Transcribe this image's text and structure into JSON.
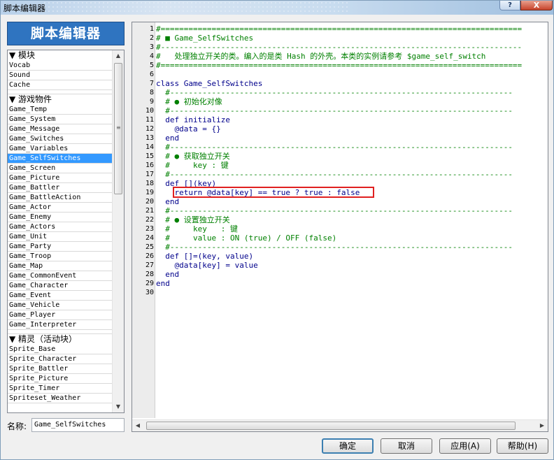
{
  "window": {
    "title": "脚本编辑器",
    "help_label": "?",
    "close_label": "X"
  },
  "left_panel": {
    "header": "脚本编辑器",
    "groups": [
      {
        "label": "▼ 模块",
        "items": [
          "Vocab",
          "Sound",
          "Cache"
        ]
      },
      {
        "label": "▼ 游戏物件",
        "items": [
          "Game_Temp",
          "Game_System",
          "Game_Message",
          "Game_Switches",
          "Game_Variables",
          "Game_SelfSwitches",
          "Game_Screen",
          "Game_Picture",
          "Game_Battler",
          "Game_BattleAction",
          "Game_Actor",
          "Game_Enemy",
          "Game_Actors",
          "Game_Unit",
          "Game_Party",
          "Game_Troop",
          "Game_Map",
          "Game_CommonEvent",
          "Game_Character",
          "Game_Event",
          "Game_Vehicle",
          "Game_Player",
          "Game_Interpreter"
        ]
      },
      {
        "label": "▼ 精灵（活动块）",
        "items": [
          "Sprite_Base",
          "Sprite_Character",
          "Sprite_Battler",
          "Sprite_Picture",
          "Sprite_Timer",
          "Spriteset_Weather"
        ]
      }
    ],
    "selected_item": "Game_SelfSwitches",
    "name_label": "名称:",
    "name_value": "Game_SelfSwitches"
  },
  "editor": {
    "lines": [
      {
        "n": "1",
        "text": "#=============================================================================="
      },
      {
        "n": "2",
        "text": "# ■ Game_SelfSwitches"
      },
      {
        "n": "3",
        "text": "#------------------------------------------------------------------------------"
      },
      {
        "n": "4",
        "text": "#   处理独立开关的类。编入的是类 Hash 的外壳。本类的实例请参考 $game_self_switch"
      },
      {
        "n": "5",
        "text": "#=============================================================================="
      },
      {
        "n": "6",
        "text": ""
      },
      {
        "n": "7",
        "text": "class Game_SelfSwitches"
      },
      {
        "n": "8",
        "text": "  #--------------------------------------------------------------------------"
      },
      {
        "n": "9",
        "text": "  # ● 初始化对像"
      },
      {
        "n": "10",
        "text": "  #--------------------------------------------------------------------------"
      },
      {
        "n": "11",
        "text": "  def initialize"
      },
      {
        "n": "12",
        "text": "    @data = {}"
      },
      {
        "n": "13",
        "text": "  end"
      },
      {
        "n": "14",
        "text": "  #--------------------------------------------------------------------------"
      },
      {
        "n": "15",
        "text": "  # ● 获取独立开关"
      },
      {
        "n": "16",
        "text": "  #     key : 键"
      },
      {
        "n": "17",
        "text": "  #--------------------------------------------------------------------------"
      },
      {
        "n": "18",
        "text": "  def [](key)"
      },
      {
        "n": "19",
        "text": "    return @data[key] == true ? true : false"
      },
      {
        "n": "20",
        "text": "  end"
      },
      {
        "n": "21",
        "text": "  #--------------------------------------------------------------------------"
      },
      {
        "n": "22",
        "text": "  # ● 设置独立开关"
      },
      {
        "n": "23",
        "text": "  #     key   : 键"
      },
      {
        "n": "24",
        "text": "  #     value : ON (true) / OFF (false)"
      },
      {
        "n": "25",
        "text": "  #--------------------------------------------------------------------------"
      },
      {
        "n": "26",
        "text": "  def []=(key, value)"
      },
      {
        "n": "27",
        "text": "    @data[key] = value"
      },
      {
        "n": "28",
        "text": "  end"
      },
      {
        "n": "29",
        "text": "end"
      },
      {
        "n": "30",
        "text": ""
      }
    ],
    "highlighted_line": "19"
  },
  "buttons": {
    "ok": "确定",
    "cancel": "取消",
    "apply": "应用(A)",
    "help": "帮助(H)"
  },
  "colors": {
    "comment": "#008000",
    "code": "#00008b",
    "selection": "#3399ff",
    "highlight_box": "#e02020",
    "header_bg": "#2f74c0"
  }
}
